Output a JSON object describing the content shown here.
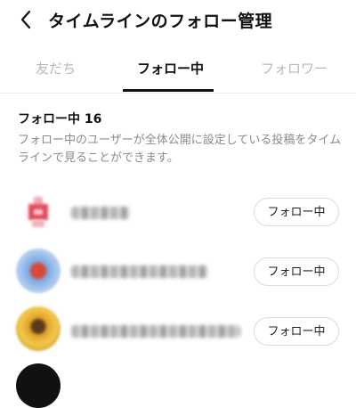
{
  "header": {
    "back_icon": "chevron-left-icon",
    "title": "タイムラインのフォロー管理"
  },
  "tabs": [
    {
      "label": "友だち",
      "active": false
    },
    {
      "label": "フォロー中",
      "active": true
    },
    {
      "label": "フォロワー",
      "active": false
    }
  ],
  "section": {
    "count_label": "フォロー中 16",
    "description": "フォロー中のユーザーが全体公開に設定している投稿をタイムラインで見ることができます。"
  },
  "follows": [
    {
      "button_label": "フォロー中"
    },
    {
      "button_label": "フォロー中"
    },
    {
      "button_label": "フォロー中"
    }
  ]
}
